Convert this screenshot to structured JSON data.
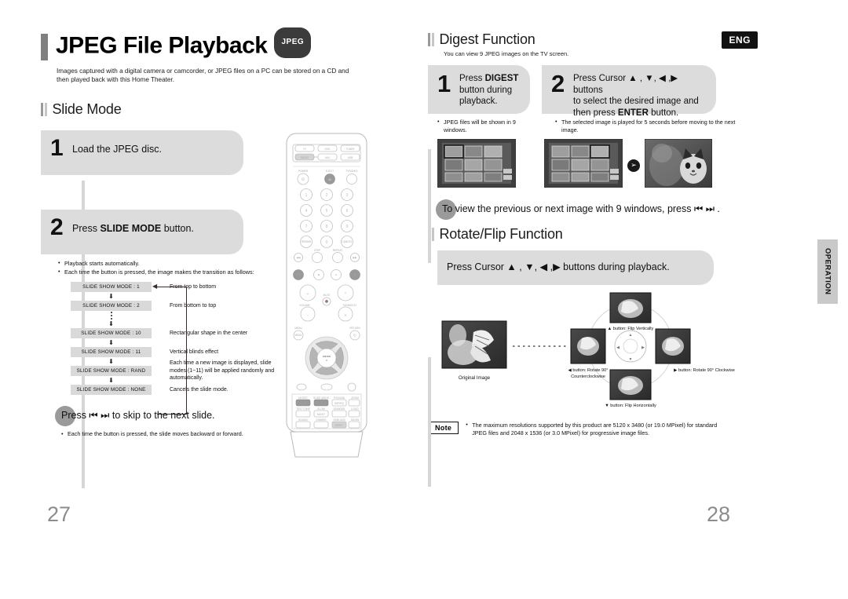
{
  "document": {
    "language_badge": "ENG",
    "side_tab": "OPERATION",
    "page_left": "27",
    "page_right": "28"
  },
  "left": {
    "title": "JPEG File Playback",
    "title_badge": "JPEG",
    "intro": "Images captured with a digital camera or camcorder, or JPEG files on a PC can be stored on a CD and then played back with this Home Theater.",
    "section_title": "Slide Mode",
    "steps": [
      {
        "num": "1",
        "text_before": "Load the JPEG disc.",
        "bold": "",
        "text_after": ""
      },
      {
        "num": "2",
        "text_before": "Press ",
        "bold": "SLIDE MODE",
        "text_after": " button."
      }
    ],
    "bullets": [
      "Playback starts automatically.",
      "Each time the button is pressed, the image makes the transition as follows:"
    ],
    "flow": [
      {
        "box": "SLIDE SHOW MODE : 1",
        "desc": "From top to bottom"
      },
      {
        "box": "SLIDE SHOW MODE : 2",
        "desc": "From bottom to top"
      },
      {
        "box": "SLIDE SHOW MODE : 10",
        "desc": "Rectangular shape in the center"
      },
      {
        "box": "SLIDE SHOW MODE : 11",
        "desc": "Vertical blinds effect"
      },
      {
        "box": "SLIDE SHOW MODE : RAND",
        "desc": "Each time a new image is displayed, slide modes (1~11) will be applied randomly and automatically."
      },
      {
        "box": "SLIDE SHOW MODE : NONE",
        "desc": "Cancels the slide mode."
      }
    ],
    "press_skip": "Press ⏮ ⏭  to skip to the next slide.",
    "press_skip_note": "Each time the button is pressed, the slide moves backward or forward."
  },
  "right": {
    "digest": {
      "section_title": "Digest Function",
      "subtitle": "You can view 9 JPEG images on the TV screen.",
      "steps": [
        {
          "num": "1",
          "line1_a": "Press ",
          "line1_b": "DIGEST",
          "line2": "button during",
          "line3": "playback."
        },
        {
          "num": "2",
          "line1": "Press Cursor ▲ , ▼, ◀ ,▶ buttons",
          "line2": "to select the desired image and",
          "line3_a": "then press ",
          "line3_b": "ENTER",
          "line3_c": " button."
        }
      ],
      "bullet_1": "JPEG files will be shown in 9 windows.",
      "bullet_2": "The selected image is played for 5 seconds before moving to the next image.",
      "press_line": "To view the previous or next image with 9 windows, press ⏮ ⏭  ."
    },
    "rotate": {
      "section_title": "Rotate/Flip Function",
      "instruction": "Press Cursor ▲ , ▼, ◀ ,▶  buttons during playback.",
      "caption_original": "Original Image",
      "caption_up": "▲ button: Flip Vertically",
      "caption_down": "▼ button: Flip Horizontally",
      "caption_left": "◀ button: Rotate 90° Counterclockwise",
      "caption_right": "▶ button: Rotate 90° Clockwise"
    },
    "note": {
      "badge": "Note",
      "text": "The maximum resolutions supported by this product are 5120 x 3480 (or 19.0 MPixel) for standard JPEG files and 2048 x 1536 (or 3.0 MPixel) for progressive image files."
    }
  },
  "remote": {
    "source_buttons": [
      "TV",
      "DVD",
      "TUNER",
      "RADIO",
      "AUX",
      "USB"
    ],
    "power_label": "POWER",
    "eject_label": "EJECT",
    "tvvideo_label": "TV/VIDEO",
    "numbers": [
      "1",
      "2",
      "3",
      "4",
      "5",
      "6",
      "7",
      "8",
      "9",
      "0"
    ],
    "remain_label": "REMAIN",
    "cancel_label": "CANCEL",
    "step_label": "STEP",
    "repeat_label": "REPEAT",
    "volume_label": "VOLUME",
    "mute_label": "MUTE",
    "tuning_label": "TUNING/CH",
    "menu_label": "MENU",
    "return_label": "RETURN",
    "enter_label": "ENTER",
    "highlight_buttons": [
      "DIGEST",
      "SLIDE MODE"
    ],
    "lower_buttons": [
      "DIGEST",
      "SLIDE MODE",
      "P.SOUND",
      "ZOOM",
      "DSP/EQ",
      "TEST TONE",
      "SLOW",
      "SD/MODE",
      "LOGO",
      "MO/ST",
      "SOUND",
      "DIMMER",
      "HDMI AUD",
      "SD/SW",
      "RESET"
    ]
  }
}
